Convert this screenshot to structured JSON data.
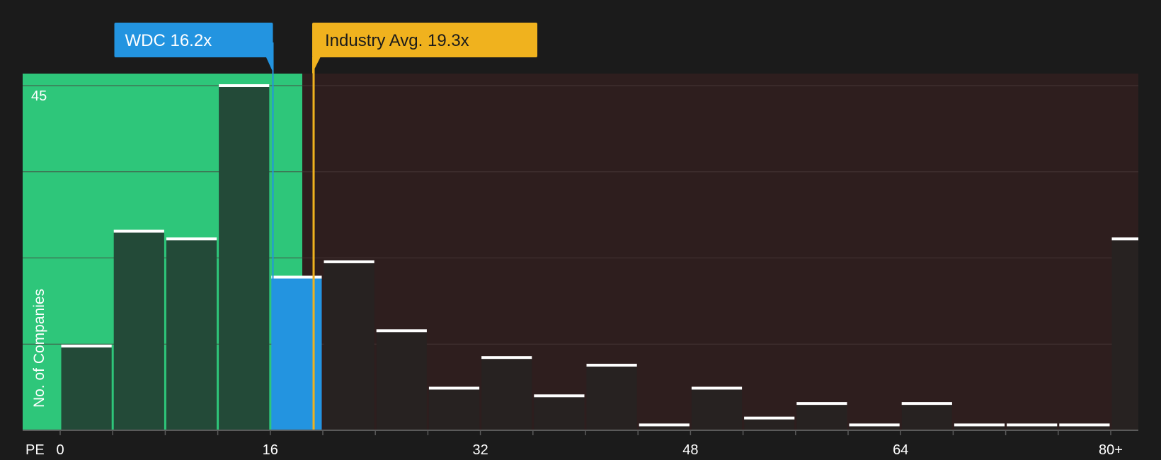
{
  "colors": {
    "background": "#1b1b1b",
    "undervalued_zone": "#2ec67a",
    "overvalued_zone": "#2e1e1e",
    "company": "#2394e0",
    "industry": "#f0b21e",
    "bar_dark": "#272221",
    "bar_in_zone": "#234a38",
    "bar_cap": "#ffffff",
    "grid": "#4a3a3a",
    "text": "#ffffff"
  },
  "company_marker": {
    "label": "WDC 16.2x",
    "value": 16.2
  },
  "industry_marker": {
    "label": "Industry Avg. 19.3x",
    "value": 19.3
  },
  "chart_data": {
    "type": "bar",
    "title": "",
    "xlabel": "PE",
    "ylabel": "No. of Companies",
    "x_ticks": [
      "0",
      "16",
      "32",
      "48",
      "64",
      "80+"
    ],
    "x_tick_values": [
      0,
      16,
      32,
      48,
      64,
      80
    ],
    "y_ticks": [
      "45"
    ],
    "y_tick_values": [
      45
    ],
    "ylim": [
      0,
      45
    ],
    "bin_width": 4,
    "grid": true,
    "bins": [
      {
        "start": 0,
        "value": 11
      },
      {
        "start": 4,
        "value": 26
      },
      {
        "start": 8,
        "value": 25
      },
      {
        "start": 12,
        "value": 45
      },
      {
        "start": 16,
        "value": 20
      },
      {
        "start": 20,
        "value": 22
      },
      {
        "start": 24,
        "value": 13
      },
      {
        "start": 28,
        "value": 5.5
      },
      {
        "start": 32,
        "value": 9.5
      },
      {
        "start": 36,
        "value": 4.5
      },
      {
        "start": 40,
        "value": 8.5
      },
      {
        "start": 44,
        "value": 0.7
      },
      {
        "start": 48,
        "value": 5.5
      },
      {
        "start": 52,
        "value": 1.6
      },
      {
        "start": 56,
        "value": 3.5
      },
      {
        "start": 60,
        "value": 0.7
      },
      {
        "start": 64,
        "value": 3.5
      },
      {
        "start": 68,
        "value": 0.7
      },
      {
        "start": 72,
        "value": 0.7
      },
      {
        "start": 76,
        "value": 0.7
      },
      {
        "start": 80,
        "value": 25
      }
    ],
    "highlighted_bin_start": 16
  }
}
